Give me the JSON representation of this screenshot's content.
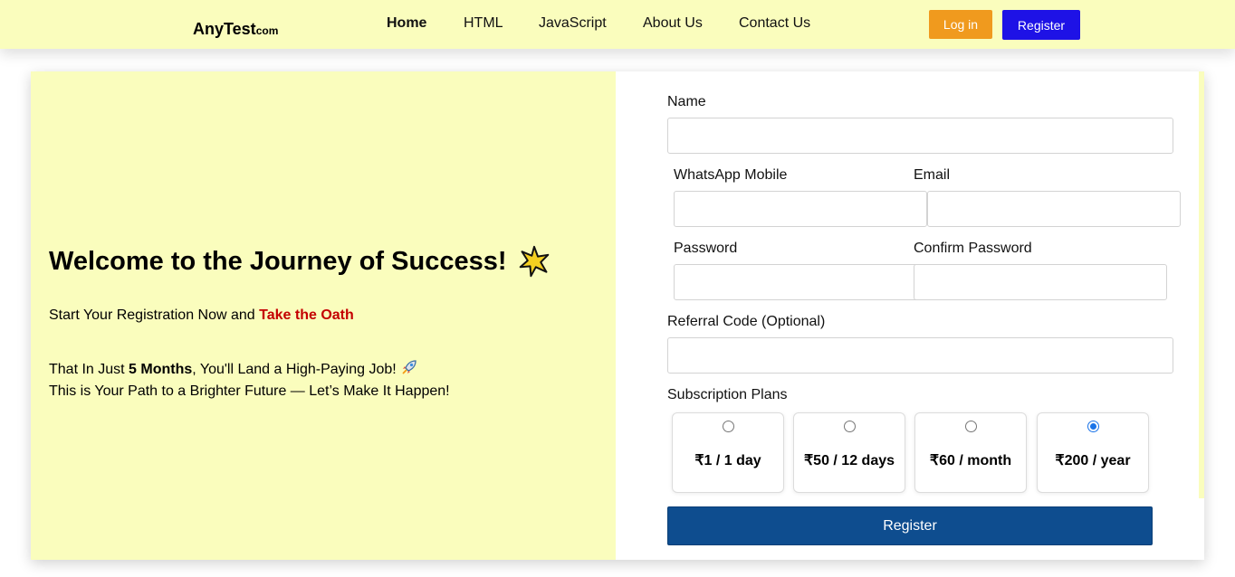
{
  "header": {
    "logo_main": "AnyTest",
    "logo_sub": "com",
    "nav": [
      "Home",
      "HTML",
      "JavaScript",
      "About Us",
      "Contact Us"
    ],
    "login_label": "Log in",
    "register_label": "Register"
  },
  "hero": {
    "title": "Welcome to the Journey of Success!",
    "line1_prefix": "Start Your Registration Now and ",
    "line1_highlight": "Take the Oath",
    "line2_prefix": "That In Just ",
    "line2_bold": "5 Months",
    "line2_suffix": ", You'll Land a High-Paying Job!",
    "line3": "This is Your Path to a Brighter Future — Let’s Make It Happen!"
  },
  "form": {
    "name_label": "Name",
    "whatsapp_label": "WhatsApp Mobile",
    "email_label": "Email",
    "password_label": "Password",
    "confirm_label": "Confirm Password",
    "referral_label": "Referral Code (Optional)",
    "plans_label": "Subscription Plans",
    "plans": [
      {
        "label": "₹1 / 1 day",
        "selected": false
      },
      {
        "label": "₹50 / 12 days",
        "selected": false
      },
      {
        "label": "₹60 / month",
        "selected": false
      },
      {
        "label": "₹200 / year",
        "selected": true
      }
    ],
    "submit_label": "Register"
  },
  "icons": {
    "hero_title_icon": "star-icon",
    "rocket": "rocket-icon"
  },
  "colors": {
    "header_bg": "#fafdbd",
    "login_btn": "#f09a1e",
    "register_btn": "#1e12e6",
    "oath_text": "#c40000",
    "submit_btn": "#0e4d8f"
  }
}
